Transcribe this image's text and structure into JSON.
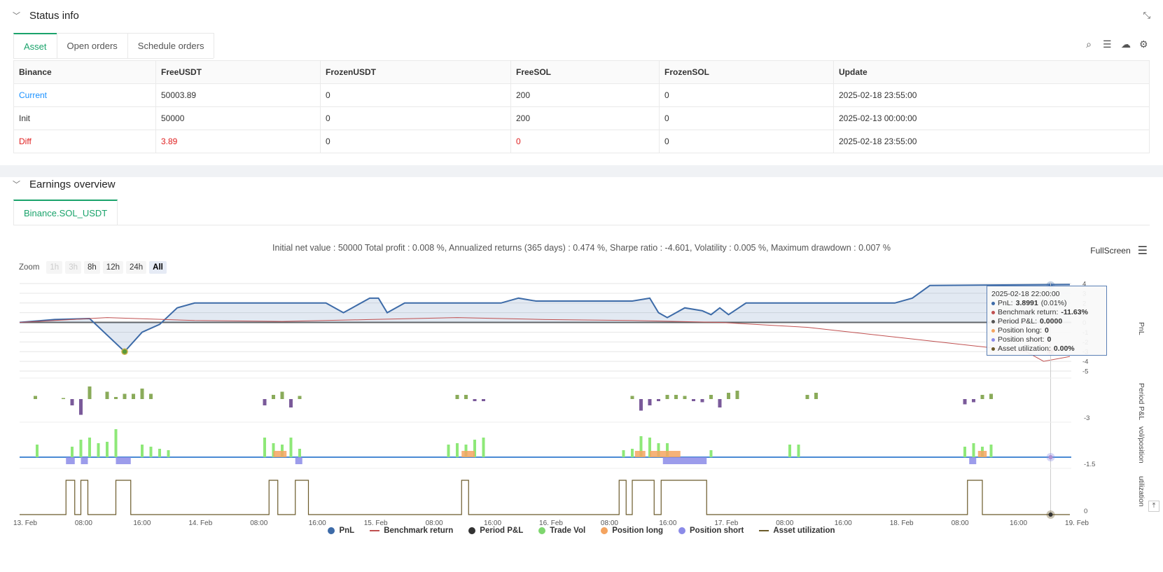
{
  "status": {
    "title": "Status info",
    "tabs": [
      "Asset",
      "Open orders",
      "Schedule orders"
    ],
    "table": {
      "headers": [
        "Binance",
        "FreeUSDT",
        "FrozenUSDT",
        "FreeSOL",
        "FrozenSOL",
        "Update"
      ],
      "rows": [
        [
          "Current",
          "50003.89",
          "0",
          "200",
          "0",
          "2025-02-18 23:55:00"
        ],
        [
          "Init",
          "50000",
          "0",
          "200",
          "0",
          "2025-02-13 00:00:00"
        ],
        [
          "Diff",
          "3.89",
          "0",
          "0",
          "0",
          "2025-02-18 23:55:00"
        ]
      ]
    }
  },
  "earnings": {
    "title": "Earnings overview",
    "tab": "Binance.SOL_USDT",
    "summary": "Initial net value : 50000 Total profit : 0.008 %, Annualized returns (365 days) : 0.474 %, Sharpe ratio : -4.601, Volatility : 0.005 %, Maximum drawdown : 0.007 %",
    "fullscreen_label": "FullScreen",
    "zoom": {
      "label": "Zoom",
      "buttons": [
        "1h",
        "3h",
        "8h",
        "12h",
        "24h",
        "All"
      ],
      "active": "All"
    },
    "tooltip": {
      "date": "2025-02-18 22:00:00",
      "pnl_label": "PnL: ",
      "pnl_value": "3.8991",
      "pnl_pct": "(0.01%)",
      "bench_label": "Benchmark return: ",
      "bench_value": "-11.63%",
      "period_label": "Period P&L: ",
      "period_value": "0.0000",
      "long_label": "Position long: ",
      "long_value": "0",
      "short_label": "Position short: ",
      "short_value": "0",
      "util_label": "Asset utilization: ",
      "util_value": "0.00%"
    },
    "legend": [
      {
        "name": "PnL",
        "color": "#3d6ba8",
        "kind": "dot"
      },
      {
        "name": "Benchmark return",
        "color": "#c05050",
        "kind": "line"
      },
      {
        "name": "Period P&L",
        "color": "#333333",
        "kind": "dot"
      },
      {
        "name": "Trade Vol",
        "color": "#7ed66e",
        "kind": "dot"
      },
      {
        "name": "Position long",
        "color": "#f4a460",
        "kind": "dot"
      },
      {
        "name": "Position short",
        "color": "#8b8be8",
        "kind": "dot"
      },
      {
        "name": "Asset utilization",
        "color": "#6b5a2a",
        "kind": "line"
      }
    ],
    "pane_labels": [
      "PnL",
      "Period P&L",
      "vol/position",
      "utilization"
    ],
    "right_axis_labels": {
      "pnl": [
        "4",
        "3",
        "2",
        "1",
        "0",
        "-1",
        "-2",
        "-3",
        "-4",
        "-5"
      ],
      "period": "-3",
      "vol": "-1.5",
      "util": "0"
    },
    "x_labels": [
      "13. Feb",
      "08:00",
      "16:00",
      "14. Feb",
      "08:00",
      "16:00",
      "15. Feb",
      "08:00",
      "16:00",
      "16. Feb",
      "08:00",
      "16:00",
      "17. Feb",
      "08:00",
      "16:00",
      "18. Feb",
      "08:00",
      "16:00",
      "19. Feb"
    ]
  },
  "chart_data": {
    "type": "line",
    "series": [
      {
        "name": "PnL",
        "points": [
          [
            0,
            0
          ],
          [
            4,
            0.3
          ],
          [
            8,
            0.4
          ],
          [
            12,
            -3
          ],
          [
            14,
            -1
          ],
          [
            16,
            -0.2
          ],
          [
            18,
            1.5
          ],
          [
            20,
            2
          ],
          [
            28,
            2
          ],
          [
            35,
            2
          ],
          [
            37,
            1
          ],
          [
            38,
            1.5
          ],
          [
            40,
            2.5
          ],
          [
            41,
            2.5
          ],
          [
            42,
            1
          ],
          [
            44,
            2
          ],
          [
            55,
            2
          ],
          [
            57,
            2.5
          ],
          [
            59,
            2.2
          ],
          [
            62,
            2.2
          ],
          [
            70,
            2.2
          ],
          [
            72,
            2.5
          ],
          [
            73,
            1
          ],
          [
            74,
            0.5
          ],
          [
            76,
            1.5
          ],
          [
            78,
            1.2
          ],
          [
            79,
            0.8
          ],
          [
            80,
            1.5
          ],
          [
            81,
            0.8
          ],
          [
            83,
            2
          ],
          [
            92,
            2
          ],
          [
            100,
            2
          ],
          [
            102,
            2.5
          ],
          [
            104,
            3.8
          ],
          [
            120,
            3.9
          ]
        ]
      },
      {
        "name": "Benchmark return",
        "points": [
          [
            0,
            0
          ],
          [
            10,
            0.5
          ],
          [
            20,
            0.2
          ],
          [
            30,
            0.1
          ],
          [
            40,
            0.3
          ],
          [
            50,
            0.5
          ],
          [
            60,
            0.3
          ],
          [
            70,
            0.2
          ],
          [
            80,
            0
          ],
          [
            90,
            -0.5
          ],
          [
            100,
            -1.5
          ],
          [
            110,
            -2.5
          ],
          [
            115,
            -3
          ],
          [
            117,
            -4
          ],
          [
            120,
            -3.5
          ]
        ]
      }
    ]
  }
}
